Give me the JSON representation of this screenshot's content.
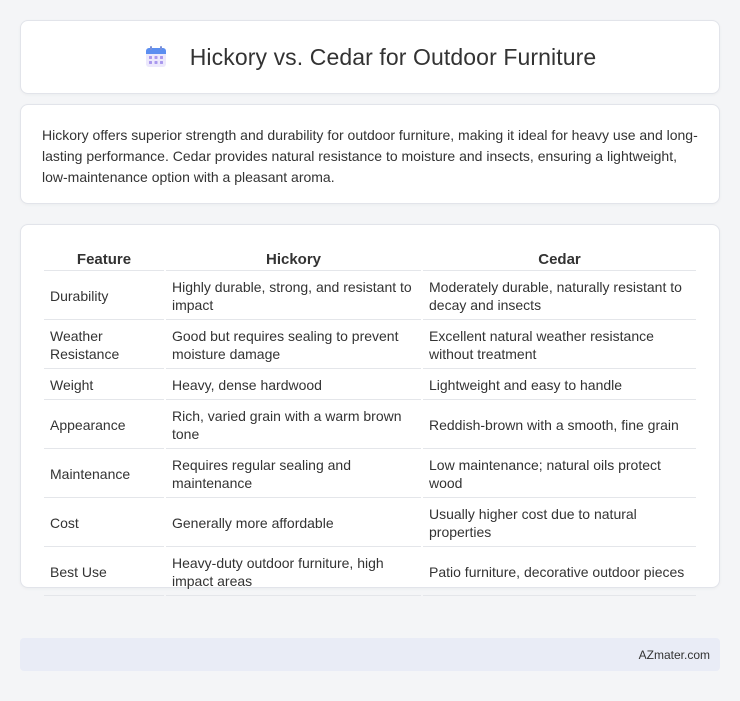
{
  "header": {
    "icon": "calendar-icon",
    "title": "Hickory vs. Cedar for Outdoor Furniture"
  },
  "intro": {
    "text": "Hickory offers superior strength and durability for outdoor furniture, making it ideal for heavy use and long-lasting performance. Cedar provides natural resistance to moisture and insects, ensuring a lightweight, low-maintenance option with a pleasant aroma."
  },
  "table": {
    "headers": [
      "Feature",
      "Hickory",
      "Cedar"
    ],
    "rows": [
      [
        "Durability",
        "Highly durable, strong, and resistant to impact",
        "Moderately durable, naturally resistant to decay and insects"
      ],
      [
        "Weather Resistance",
        "Good but requires sealing to prevent moisture damage",
        "Excellent natural weather resistance without treatment"
      ],
      [
        "Weight",
        "Heavy, dense hardwood",
        "Lightweight and easy to handle"
      ],
      [
        "Appearance",
        "Rich, varied grain with a warm brown tone",
        "Reddish-brown with a smooth, fine grain"
      ],
      [
        "Maintenance",
        "Requires regular sealing and maintenance",
        "Low maintenance; natural oils protect wood"
      ],
      [
        "Cost",
        "Generally more affordable",
        "Usually higher cost due to natural properties"
      ],
      [
        "Best Use",
        "Heavy-duty outdoor furniture, high impact areas",
        "Patio furniture, decorative outdoor pieces"
      ]
    ]
  },
  "footer": {
    "text": "AZmater.com"
  },
  "colors": {
    "page_background": "#f4f5f7",
    "card_background": "#ffffff",
    "footer_background": "#e9ecf6",
    "icon_accent": "#8f7ee8",
    "icon_header": "#5b8ef0"
  }
}
